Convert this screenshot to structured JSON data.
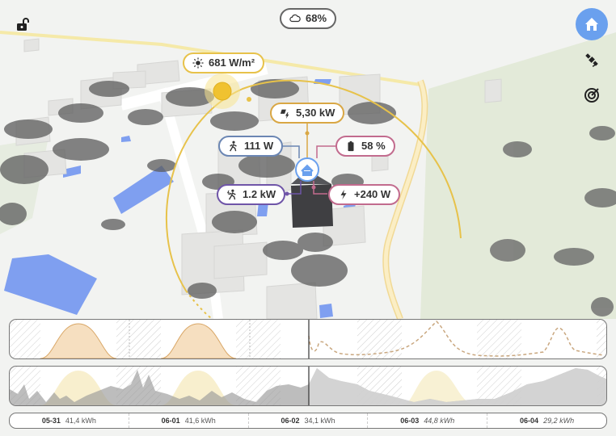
{
  "weather": {
    "cloud_cover": "68%",
    "icon": "cloud-icon"
  },
  "map_labels": {
    "irradiance": "681 W/m²",
    "pv_power": "5,30 kW",
    "house_consumption": "111 W",
    "battery": "58 %",
    "ev_consumption": "1.2 kW",
    "grid": "+240 W"
  },
  "controls": {
    "lock_icon": "unlock-icon",
    "home_button_icon": "home-icon",
    "satellite_icon": "satellite-icon",
    "radar_icon": "radar-icon"
  },
  "colors": {
    "accent": "#6aa0ee",
    "sun": "#e7c24a",
    "pv": "#d9a744",
    "house": "#6b86b3",
    "battery": "#c26b8e",
    "ev": "#6f55a8",
    "grid": "#c26b8e"
  },
  "days": [
    {
      "date": "05-31",
      "energy": "41,4 kWh",
      "forecast": false
    },
    {
      "date": "06-01",
      "energy": "41,6 kWh",
      "forecast": false
    },
    {
      "date": "06-02",
      "energy": "34,1 kWh",
      "forecast": false
    },
    {
      "date": "06-03",
      "energy": "44,8 kWh",
      "forecast": true
    },
    {
      "date": "06-04",
      "energy": "29,2 kWh",
      "forecast": true
    }
  ]
}
